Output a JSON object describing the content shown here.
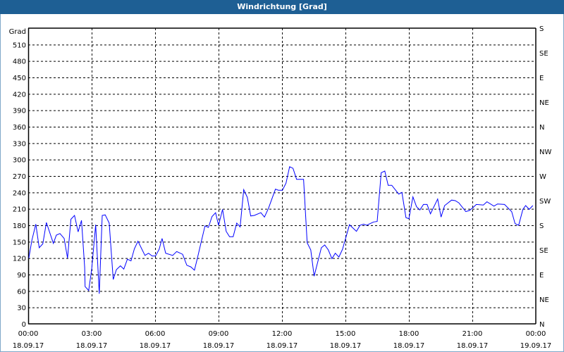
{
  "window": {
    "title": "Windrichtung [Grad]"
  },
  "chart_data": {
    "type": "line",
    "title": "Windrichtung [Grad]",
    "ylabel": "Grad",
    "ylim": [
      0,
      540
    ],
    "yticks": [
      0,
      30,
      60,
      90,
      120,
      150,
      180,
      210,
      240,
      270,
      300,
      330,
      360,
      390,
      420,
      450,
      480,
      510
    ],
    "y2ticks": [
      {
        "value": 0,
        "label": "N"
      },
      {
        "value": 45,
        "label": "NE"
      },
      {
        "value": 90,
        "label": "E"
      },
      {
        "value": 135,
        "label": "SE"
      },
      {
        "value": 180,
        "label": "S"
      },
      {
        "value": 225,
        "label": "SW"
      },
      {
        "value": 270,
        "label": "W"
      },
      {
        "value": 315,
        "label": "NW"
      },
      {
        "value": 360,
        "label": "N"
      },
      {
        "value": 405,
        "label": "NE"
      },
      {
        "value": 450,
        "label": "E"
      },
      {
        "value": 495,
        "label": "SE"
      },
      {
        "value": 540,
        "label": "S"
      }
    ],
    "xlim_hours": [
      0,
      24
    ],
    "xticks": [
      {
        "hour": 0,
        "time": "00:00",
        "date": "18.09.17"
      },
      {
        "hour": 3,
        "time": "03:00",
        "date": "18.09.17"
      },
      {
        "hour": 6,
        "time": "06:00",
        "date": "18.09.17"
      },
      {
        "hour": 9,
        "time": "09:00",
        "date": "18.09.17"
      },
      {
        "hour": 12,
        "time": "12:00",
        "date": "18.09.17"
      },
      {
        "hour": 15,
        "time": "15:00",
        "date": "18.09.17"
      },
      {
        "hour": 18,
        "time": "18:00",
        "date": "18.09.17"
      },
      {
        "hour": 21,
        "time": "21:00",
        "date": "18.09.17"
      },
      {
        "hour": 24,
        "time": "00:00",
        "date": "19.09.17"
      }
    ],
    "grid": true,
    "series": [
      {
        "name": "Windrichtung",
        "color": "#0000ff",
        "x": [
          0.03,
          0.17,
          0.36,
          0.52,
          0.69,
          0.86,
          1.19,
          1.33,
          1.5,
          1.7,
          1.86,
          2.02,
          2.19,
          2.36,
          2.52,
          2.67,
          2.69,
          2.86,
          3.0,
          3.19,
          3.36,
          3.5,
          3.64,
          3.83,
          4.02,
          4.17,
          4.36,
          4.52,
          4.69,
          4.86,
          5.02,
          5.19,
          5.52,
          5.69,
          5.86,
          6.02,
          6.19,
          6.33,
          6.5,
          6.83,
          7.02,
          7.3,
          7.5,
          7.69,
          7.86,
          8.0,
          8.17,
          8.36,
          8.52,
          8.69,
          8.86,
          9.0,
          9.19,
          9.36,
          9.52,
          9.69,
          9.86,
          10.02,
          10.19,
          10.36,
          10.52,
          10.69,
          11.0,
          11.17,
          11.36,
          11.69,
          11.83,
          12.02,
          12.19,
          12.36,
          12.52,
          12.69,
          13.02,
          13.19,
          13.36,
          13.52,
          13.86,
          14.02,
          14.19,
          14.36,
          14.52,
          14.69,
          14.86,
          15.19,
          15.52,
          15.69,
          15.86,
          16.0,
          16.33,
          16.5,
          16.69,
          16.86,
          17.02,
          17.19,
          17.52,
          17.67,
          17.86,
          18.0,
          18.19,
          18.36,
          18.52,
          18.69,
          18.86,
          19.02,
          19.36,
          19.52,
          19.69,
          20.02,
          20.19,
          20.36,
          20.69,
          20.86,
          21.02,
          21.19,
          21.52,
          21.69,
          22.02,
          22.19,
          22.52,
          22.86,
          23.02,
          23.19,
          23.39,
          23.52,
          23.69,
          23.86
        ],
        "values": [
          120,
          152,
          182,
          139,
          146,
          185,
          147,
          162,
          165,
          156,
          120,
          191,
          198,
          168,
          189,
          103,
          68,
          61,
          99,
          181,
          55,
          198,
          199,
          184,
          81,
          99,
          106,
          100,
          118,
          115,
          137,
          151,
          125,
          129,
          124,
          124,
          136,
          156,
          129,
          125,
          132,
          127,
          107,
          104,
          98,
          120,
          148,
          179,
          176,
          196,
          203,
          180,
          209,
          169,
          159,
          159,
          184,
          177,
          245,
          231,
          197,
          198,
          203,
          195,
          211,
          246,
          244,
          244,
          257,
          287,
          284,
          264,
          264,
          148,
          135,
          87,
          139,
          144,
          135,
          119,
          129,
          122,
          136,
          181,
          169,
          180,
          182,
          180,
          186,
          187,
          276,
          279,
          253,
          253,
          237,
          240,
          194,
          192,
          232,
          214,
          208,
          218,
          218,
          201,
          228,
          195,
          216,
          226,
          225,
          221,
          205,
          207,
          212,
          218,
          217,
          223,
          215,
          219,
          218,
          205,
          183,
          180,
          209,
          216,
          209,
          216
        ]
      }
    ]
  }
}
